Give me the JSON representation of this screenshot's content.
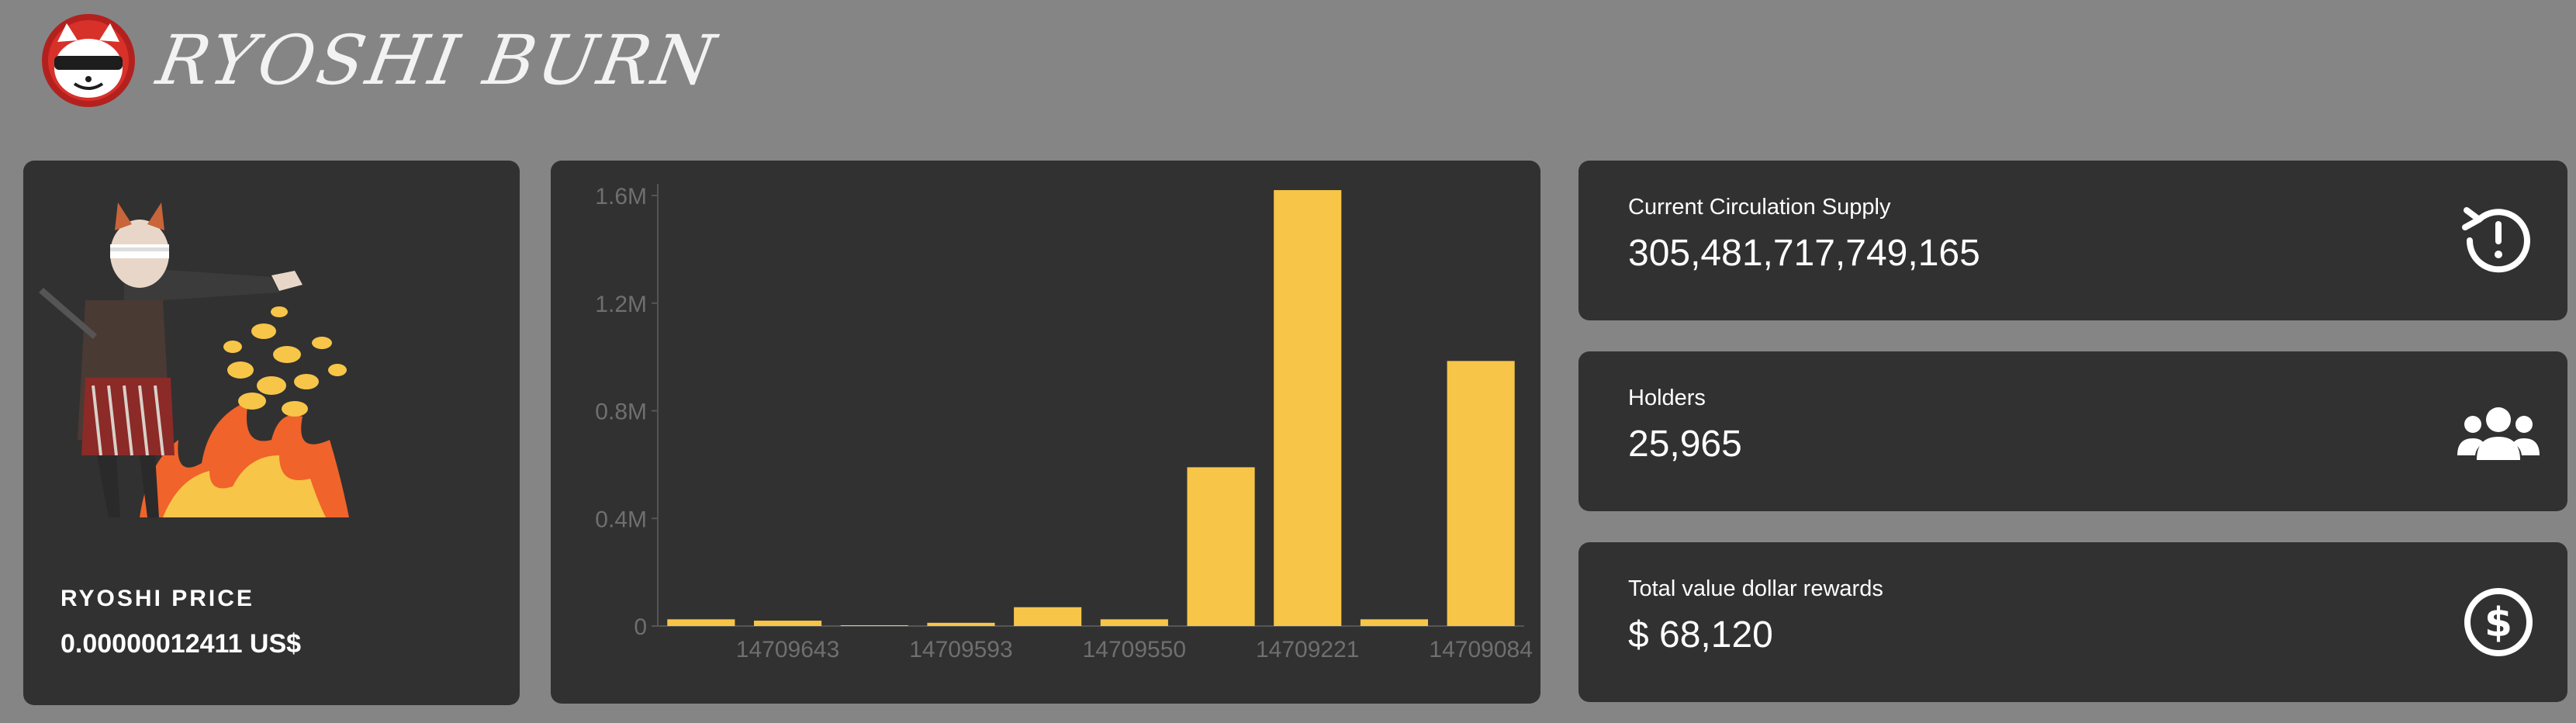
{
  "header": {
    "brand": "RYOSHI BURN",
    "logo_icon": "ryoshi-cat-logo-icon"
  },
  "price_card": {
    "title": "RYOSHI PRICE",
    "value": "0.00000012411 US$",
    "illustration": "samurai-cat-burning-coins"
  },
  "stats": {
    "supply": {
      "label": "Current Circulation Supply",
      "value": "305,481,717,749,165",
      "icon": "history-alert-icon"
    },
    "holders": {
      "label": "Holders",
      "value": "25,965",
      "icon": "users-icon"
    },
    "rewards": {
      "label": "Total value dollar rewards",
      "value": "$ 68,120",
      "icon": "dollar-circle-icon"
    }
  },
  "colors": {
    "background": "#858585",
    "panel": "#313131",
    "accent": "#f7c548",
    "axis_text": "#6f6f6f"
  },
  "chart_data": {
    "type": "bar",
    "categories": [
      "",
      "14709643",
      "",
      "14709593",
      "",
      "14709550",
      "",
      "14709221",
      "",
      "14709084"
    ],
    "values": [
      25000,
      20000,
      3000,
      12000,
      70000,
      25000,
      590000,
      1620000,
      25000,
      985000
    ],
    "y_ticks": [
      "0",
      "0.4M",
      "0.8M",
      "1.2M",
      "1.6M"
    ],
    "y_tick_values": [
      0,
      400000,
      800000,
      1200000,
      1600000
    ],
    "ylim": [
      0,
      1600000
    ],
    "title": "",
    "xlabel": "",
    "ylabel": "",
    "grid": false,
    "bar_color": "#f7c548"
  }
}
